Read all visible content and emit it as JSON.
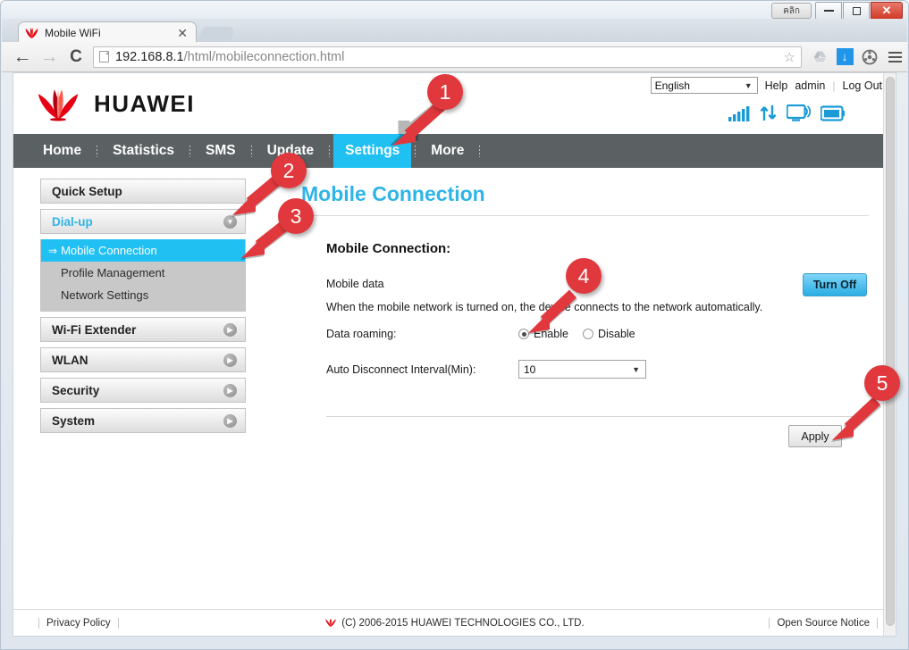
{
  "os_window": {
    "thai_button_label": "คลิก",
    "minimize_label": "",
    "maximize_label": "",
    "close_label": "✕"
  },
  "browser": {
    "tab": {
      "title": "Mobile WiFi",
      "close_label": "✕",
      "favicon": "huawei-flower-icon"
    },
    "new_tab_label": "",
    "nav": {
      "back_label": "←",
      "forward_label": "→",
      "reload_label": "C"
    },
    "omnibox": {
      "url_host": "192.168.8.1",
      "url_path": "/html/mobileconnection.html",
      "page_icon": "document-icon",
      "star_label": "☆"
    },
    "extensions": [
      {
        "name": "google-drive-icon",
        "label": ""
      },
      {
        "name": "download-manager-icon",
        "label": "↓"
      },
      {
        "name": "video-downloader-icon",
        "label": ""
      },
      {
        "name": "chrome-menu-icon",
        "label": ""
      }
    ]
  },
  "page": {
    "brand": {
      "name": "HUAWEI",
      "logo": "huawei-flower-logo"
    },
    "header": {
      "language": "English",
      "language_caret": "▼",
      "help_label": "Help",
      "user_label": "admin",
      "logout_label": "Log Out",
      "separator": "|",
      "status_icons": [
        "signal-bars-icon",
        "data-transfer-icon",
        "wifi-monitor-icon",
        "battery-icon"
      ]
    },
    "nav": {
      "items": [
        {
          "label": "Home",
          "active": false
        },
        {
          "label": "Statistics",
          "active": false
        },
        {
          "label": "SMS",
          "active": false
        },
        {
          "label": "Update",
          "active": false
        },
        {
          "label": "Settings",
          "active": true
        },
        {
          "label": "More",
          "active": false
        }
      ]
    },
    "sidebar": {
      "items": [
        {
          "label": "Quick Setup",
          "expandable": false,
          "state": "closed"
        },
        {
          "label": "Dial-up",
          "expandable": true,
          "state": "open"
        },
        {
          "label": "Wi-Fi Extender",
          "expandable": true,
          "state": "closed"
        },
        {
          "label": "WLAN",
          "expandable": true,
          "state": "closed"
        },
        {
          "label": "Security",
          "expandable": true,
          "state": "closed"
        },
        {
          "label": "System",
          "expandable": true,
          "state": "closed"
        }
      ],
      "submenu": [
        {
          "label": "Mobile Connection",
          "selected": true,
          "marker": "⇒"
        },
        {
          "label": "Profile Management",
          "selected": false
        },
        {
          "label": "Network Settings",
          "selected": false
        }
      ],
      "expand_open_glyph": "▼",
      "expand_closed_glyph": "▶"
    },
    "content": {
      "title": "Mobile Connection",
      "section_title": "Mobile Connection:",
      "mobile_data_label": "Mobile data",
      "turn_off_button": "Turn Off",
      "description": "When the mobile network is turned on, the device connects to the network automatically.",
      "data_roaming_label": "Data roaming:",
      "roaming_options": [
        {
          "label": "Enable",
          "selected": true
        },
        {
          "label": "Disable",
          "selected": false
        }
      ],
      "interval_label": "Auto Disconnect Interval(Min):",
      "interval_value": "10",
      "interval_caret": "▼",
      "apply_button": "Apply"
    },
    "footer": {
      "privacy_policy": "Privacy Policy",
      "copyright": "(C) 2006-2015 HUAWEI TECHNOLOGIES CO., LTD.",
      "open_source": "Open Source Notice"
    }
  },
  "annotations": [
    {
      "number": "1",
      "target": "settings-tab"
    },
    {
      "number": "2",
      "target": "dial-up-expander"
    },
    {
      "number": "3",
      "target": "mobile-connection-submenu"
    },
    {
      "number": "4",
      "target": "data-roaming-enable-radio"
    },
    {
      "number": "5",
      "target": "apply-button"
    }
  ],
  "colors": {
    "accent_blue": "#20c0f3",
    "huawei_red": "#e60012",
    "nav_gray": "#5b6063",
    "annotation_red": "#e0383c"
  }
}
